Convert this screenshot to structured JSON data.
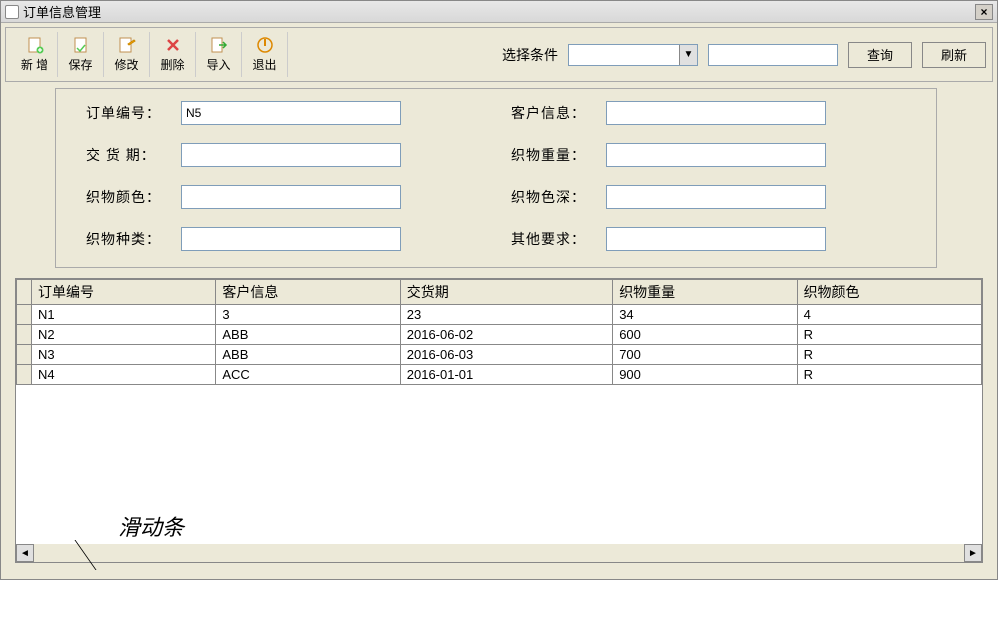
{
  "titlebar": {
    "icon": "document-icon",
    "title": "订单信息管理",
    "close": "×"
  },
  "toolbar": {
    "add": "新 增",
    "save": "保存",
    "modify": "修改",
    "delete": "删除",
    "import": "导入",
    "exit": "退出",
    "filter_label": "选择条件",
    "combo_value": "",
    "text_value": "",
    "query": "查询",
    "refresh": "刷新"
  },
  "form": {
    "order_no_label": "订单编号：",
    "order_no_value": "N5",
    "cust_label": "客户信息：",
    "cust_value": "",
    "delivery_label": "交 货 期：",
    "delivery_value": "",
    "weight_label": "织物重量：",
    "weight_value": "",
    "color_label": "织物颜色：",
    "color_value": "",
    "depth_label": "织物色深：",
    "depth_value": "",
    "type_label": "织物种类：",
    "type_value": "",
    "other_label": "其他要求：",
    "other_value": ""
  },
  "table": {
    "headers": {
      "order_no": "订单编号",
      "customer": "客户信息",
      "delivery": "交货期",
      "weight": "织物重量",
      "color": "织物颜色"
    },
    "rows": [
      {
        "order_no": "N1",
        "customer": "3",
        "delivery": "23",
        "weight": "34",
        "color": "4"
      },
      {
        "order_no": "N2",
        "customer": "ABB",
        "delivery": "2016-06-02",
        "weight": "600",
        "color": "R"
      },
      {
        "order_no": "N3",
        "customer": "ABB",
        "delivery": "2016-06-03",
        "weight": "700",
        "color": "R"
      },
      {
        "order_no": "N4",
        "customer": "ACC",
        "delivery": "2016-01-01",
        "weight": "900",
        "color": "R"
      }
    ],
    "scroll_left": "◄",
    "scroll_right": "►"
  },
  "annotation": "滑动条"
}
